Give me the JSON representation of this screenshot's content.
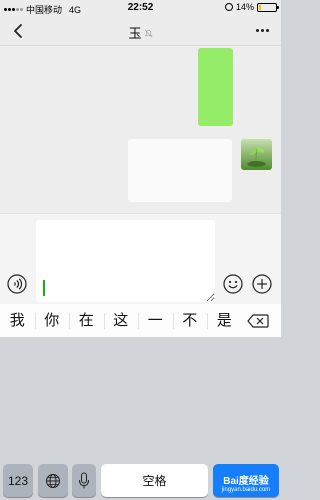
{
  "status_bar": {
    "carrier": "中国移动",
    "network": "4G",
    "time": "22:52",
    "battery_percent": "14%",
    "battery_level": 0.14
  },
  "nav": {
    "title": "玉",
    "icons": {
      "back": "chevron-left-icon",
      "silent": "mute-bell-icon",
      "more": "more-dots-icon"
    }
  },
  "chat": {
    "avatar_colors": {
      "top": "#c8e0b0",
      "bottom": "#4f8a2e"
    },
    "bubble_colors": {
      "mine": "#95ec69",
      "theirs": "#fafafa"
    }
  },
  "input_bar": {
    "input_value": "",
    "icons": {
      "voice": "voice-icon",
      "emoji": "emoji-icon",
      "more": "plus-icon"
    }
  },
  "candidates": [
    "我",
    "你",
    "在",
    "这",
    "一",
    "不",
    "是"
  ],
  "keyboard": {
    "numeric_label": "123",
    "space_label": "空格",
    "icons": {
      "globe": "globe-icon",
      "mic": "microphone-icon",
      "delete": "delete-icon"
    },
    "accent_color": "#147efb"
  },
  "watermark": {
    "brand": "Bai​度经验",
    "url": "jingyan.baidu.com"
  }
}
